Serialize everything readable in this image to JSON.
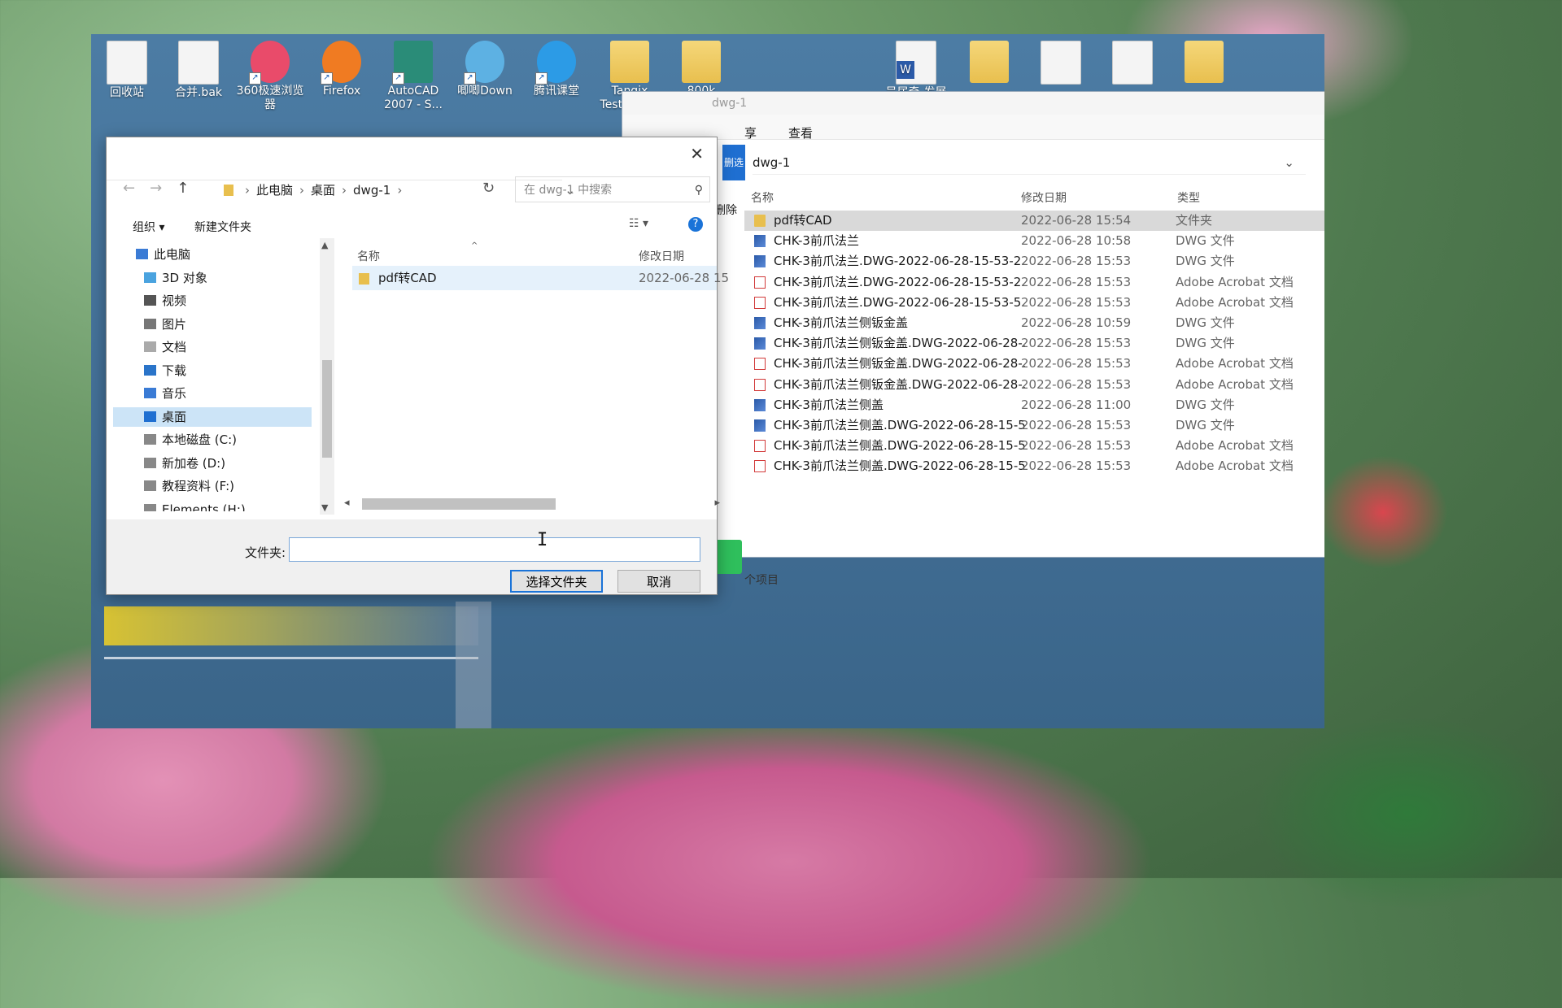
{
  "desktop": {
    "icons": [
      {
        "label": "回收站",
        "kind": "recycle"
      },
      {
        "label": "合并.bak",
        "kind": "doc"
      },
      {
        "label": "360极速浏览器",
        "kind": "round",
        "color": "#e94b6a"
      },
      {
        "label": "Firefox",
        "kind": "round",
        "color": "#f07b22"
      },
      {
        "label": "AutoCAD 2007 - S...",
        "kind": "cad",
        "color": "#2a8c78"
      },
      {
        "label": "唧唧Down",
        "kind": "round",
        "color": "#5db1e3"
      },
      {
        "label": "腾讯课堂",
        "kind": "round",
        "color": "#2c9be6"
      },
      {
        "label": "Tangix TesterPR...",
        "kind": "folder"
      },
      {
        "label": "800k",
        "kind": "folder"
      },
      {
        "label": "吴居奇-发展规划",
        "kind": "word",
        "color": "#2b5aa8"
      },
      {
        "label": "",
        "kind": "folder"
      },
      {
        "label": "",
        "kind": "doc"
      },
      {
        "label": "",
        "kind": "doc"
      },
      {
        "label": "",
        "kind": "folder"
      }
    ]
  },
  "explorer": {
    "title": "dwg-1",
    "ribbon": {
      "share": "享",
      "view": "查看"
    },
    "side": {
      "select_strip": "删选",
      "delete": "删除"
    },
    "address": "dwg-1",
    "columns": {
      "name": "名称",
      "date": "修改日期",
      "type": "类型"
    },
    "files": [
      {
        "name": "pdf转CAD",
        "date": "2022-06-28 15:54",
        "type": "文件夹",
        "icon": "folder",
        "selected": true
      },
      {
        "name": "CHK-3前爪法兰",
        "date": "2022-06-28 10:58",
        "type": "DWG 文件",
        "icon": "dwg"
      },
      {
        "name": "CHK-3前爪法兰.DWG-2022-06-28-15-53-2...",
        "date": "2022-06-28 15:53",
        "type": "DWG 文件",
        "icon": "dwg"
      },
      {
        "name": "CHK-3前爪法兰.DWG-2022-06-28-15-53-2...",
        "date": "2022-06-28 15:53",
        "type": "Adobe Acrobat 文档",
        "icon": "pdf"
      },
      {
        "name": "CHK-3前爪法兰.DWG-2022-06-28-15-53-5...",
        "date": "2022-06-28 15:53",
        "type": "Adobe Acrobat 文档",
        "icon": "pdf"
      },
      {
        "name": "CHK-3前爪法兰侧钣金盖",
        "date": "2022-06-28 10:59",
        "type": "DWG 文件",
        "icon": "dwg"
      },
      {
        "name": "CHK-3前爪法兰侧钣金盖.DWG-2022-06-28-...",
        "date": "2022-06-28 15:53",
        "type": "DWG 文件",
        "icon": "dwg"
      },
      {
        "name": "CHK-3前爪法兰侧钣金盖.DWG-2022-06-28-...",
        "date": "2022-06-28 15:53",
        "type": "Adobe Acrobat 文档",
        "icon": "pdf"
      },
      {
        "name": "CHK-3前爪法兰侧钣金盖.DWG-2022-06-28-...",
        "date": "2022-06-28 15:53",
        "type": "Adobe Acrobat 文档",
        "icon": "pdf"
      },
      {
        "name": "CHK-3前爪法兰侧盖",
        "date": "2022-06-28 11:00",
        "type": "DWG 文件",
        "icon": "dwg"
      },
      {
        "name": "CHK-3前爪法兰侧盖.DWG-2022-06-28-15-5...",
        "date": "2022-06-28 15:53",
        "type": "DWG 文件",
        "icon": "dwg"
      },
      {
        "name": "CHK-3前爪法兰侧盖.DWG-2022-06-28-15-5...",
        "date": "2022-06-28 15:53",
        "type": "Adobe Acrobat 文档",
        "icon": "pdf"
      },
      {
        "name": "CHK-3前爪法兰侧盖.DWG-2022-06-28-15-5...",
        "date": "2022-06-28 15:53",
        "type": "Adobe Acrobat 文档",
        "icon": "pdf"
      }
    ],
    "status": "个项目"
  },
  "dialog": {
    "close": "✕",
    "nav": {
      "back": "←",
      "forward": "→",
      "up": "↑"
    },
    "breadcrumb": [
      "此电脑",
      "桌面",
      "dwg-1"
    ],
    "search_placeholder": "在 dwg-1 中搜索",
    "toolbar": {
      "organize": "组织 ▾",
      "new_folder": "新建文件夹"
    },
    "tree": [
      {
        "label": "此电脑",
        "icon": "pc"
      },
      {
        "label": "3D 对象",
        "icon": "3d"
      },
      {
        "label": "视频",
        "icon": "video"
      },
      {
        "label": "图片",
        "icon": "pic"
      },
      {
        "label": "文档",
        "icon": "doc"
      },
      {
        "label": "下载",
        "icon": "down"
      },
      {
        "label": "音乐",
        "icon": "music"
      },
      {
        "label": "桌面",
        "icon": "desktop",
        "selected": true
      },
      {
        "label": "本地磁盘 (C:)",
        "icon": "drive"
      },
      {
        "label": "新加卷 (D:)",
        "icon": "drive"
      },
      {
        "label": "教程资料 (F:)",
        "icon": "drive"
      },
      {
        "label": "Elements (H:)",
        "icon": "drive"
      }
    ],
    "columns": {
      "name": "名称",
      "date": "修改日期"
    },
    "items": [
      {
        "name": "pdf转CAD",
        "date": "2022-06-28 15"
      }
    ],
    "folder_label": "文件夹:",
    "folder_value": "",
    "select_button": "选择文件夹",
    "cancel_button": "取消"
  },
  "colors": {
    "accent": "#1a73d8",
    "selection": "#cce4f7",
    "desktop": "#4c7ca4"
  }
}
